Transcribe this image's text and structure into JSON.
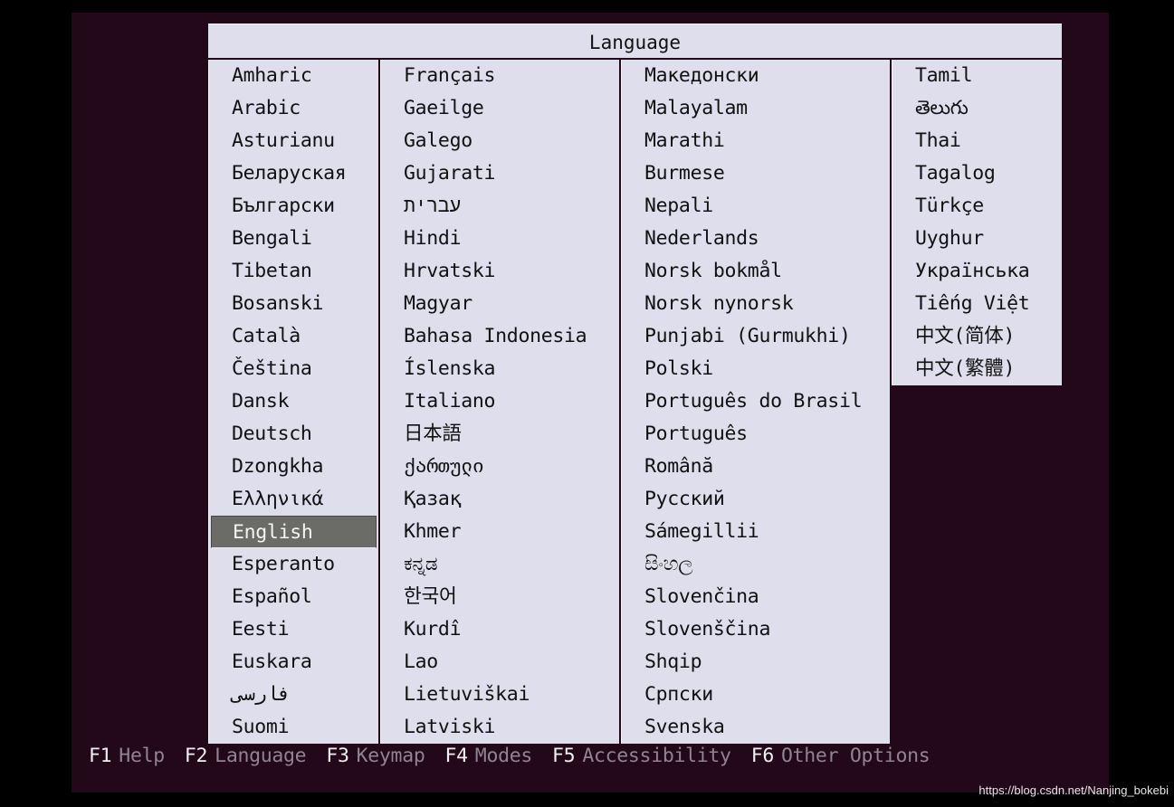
{
  "menu": {
    "title": "Language",
    "selected": "English",
    "columns": [
      [
        "Amharic",
        "Arabic",
        "Asturianu",
        "Беларуская",
        "Български",
        "Bengali",
        "Tibetan",
        "Bosanski",
        "Català",
        "Čeština",
        "Dansk",
        "Deutsch",
        "Dzongkha",
        "Ελληνικά",
        "English",
        "Esperanto",
        "Español",
        "Eesti",
        "Euskara",
        "فارسی",
        "Suomi"
      ],
      [
        "Français",
        "Gaeilge",
        "Galego",
        "Gujarati",
        "עברית",
        "Hindi",
        "Hrvatski",
        "Magyar",
        "Bahasa Indonesia",
        "Íslenska",
        "Italiano",
        "日本語",
        "ქართული",
        "Қазақ",
        "Khmer",
        "ಕನ್ನಡ",
        "한국어",
        "Kurdî",
        "Lao",
        "Lietuviškai",
        "Latviski"
      ],
      [
        "Македонски",
        "Malayalam",
        "Marathi",
        "Burmese",
        "Nepali",
        "Nederlands",
        "Norsk bokmål",
        "Norsk nynorsk",
        "Punjabi (Gurmukhi)",
        "Polski",
        "Português do Brasil",
        "Português",
        "Română",
        "Русский",
        "Sámegillii",
        "සිංහල",
        "Slovenčina",
        "Slovenščina",
        "Shqip",
        "Српски",
        "Svenska"
      ],
      [
        "Tamil",
        "తెలుగు",
        "Thai",
        "Tagalog",
        "Türkçe",
        "Uyghur",
        "Українська",
        "Tiếng Việt",
        "中文(简体)",
        "中文(繁體)"
      ]
    ]
  },
  "footer": {
    "keys": [
      {
        "key": "F1",
        "label": "Help"
      },
      {
        "key": "F2",
        "label": "Language"
      },
      {
        "key": "F3",
        "label": "Keymap"
      },
      {
        "key": "F4",
        "label": "Modes"
      },
      {
        "key": "F5",
        "label": "Accessibility"
      },
      {
        "key": "F6",
        "label": "Other Options"
      }
    ]
  },
  "watermark": "https://blog.csdn.net/Nanjing_bokebi",
  "colors": {
    "screen_bg": "#220818",
    "menu_bg": "#dedeec",
    "selected_bg": "#6b6b68",
    "footer_key": "#f0f0f0",
    "footer_label": "#8f8394"
  }
}
